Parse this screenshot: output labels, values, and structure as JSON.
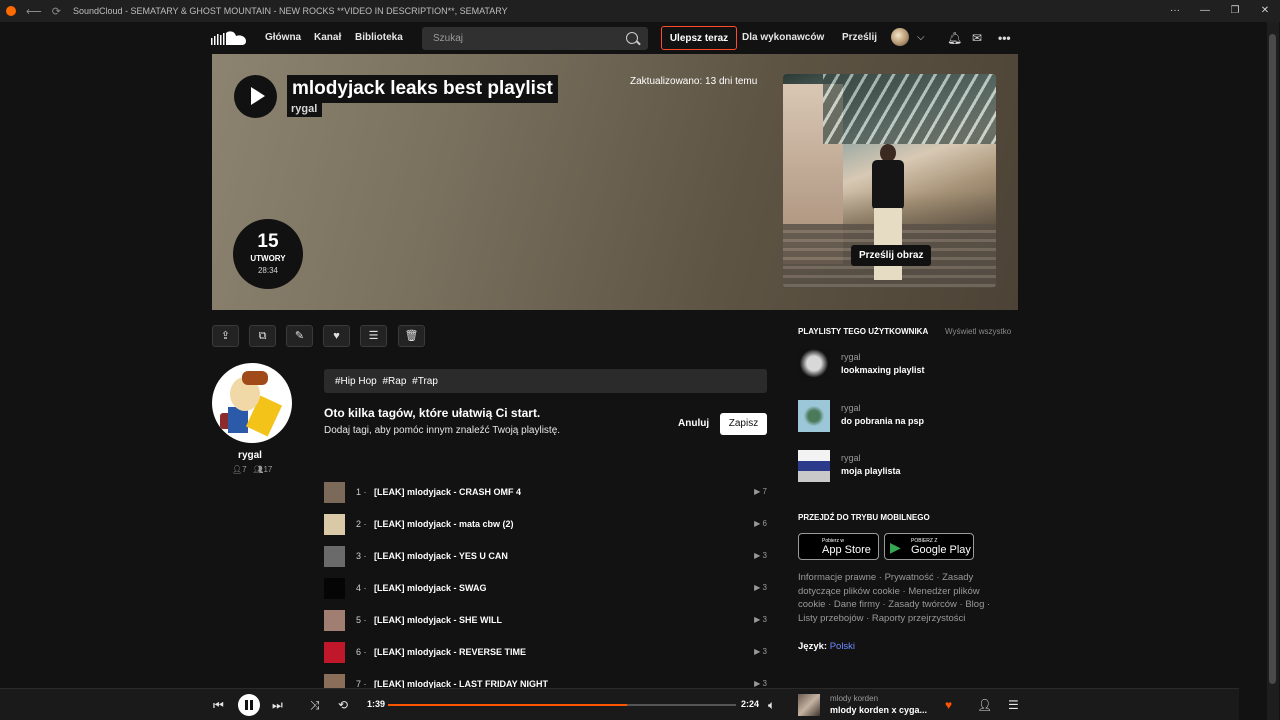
{
  "window": {
    "title": "SoundCloud - SEMATARY & GHOST MOUNTAIN - NEW ROCKS **VIDEO IN DESCRIPTION**, SEMATARY"
  },
  "nav": {
    "home": "Główna",
    "feed": "Kanał",
    "library": "Biblioteka",
    "search_placeholder": "Szukaj",
    "upgrade": "Ulepsz teraz",
    "for_artists": "Dla wykonawców",
    "upload": "Prześlij"
  },
  "playlist": {
    "title": "mlodyjack leaks best playlist",
    "user": "rygal",
    "updated": "Zaktualizowano: 13 dni temu",
    "track_count": "15",
    "track_label": "UTWORY",
    "duration": "28:34",
    "upload_image": "Prześlij obraz"
  },
  "user": {
    "name": "rygal",
    "followers": "7",
    "following": "17"
  },
  "tags": [
    "#Hip Hop",
    "#Rap",
    "#Trap"
  ],
  "tip": {
    "title": "Oto kilka tagów, które ułatwią Ci start.",
    "subtitle": "Dodaj tagi, aby pomóc innym znaleźć Twoją playlistę.",
    "cancel": "Anuluj",
    "save": "Zapisz"
  },
  "tracks": [
    {
      "num": "1",
      "title": "[LEAK] mlodyjack - CRASH OMF 4",
      "plays": "7",
      "color": "#7b6a5a"
    },
    {
      "num": "2",
      "title": "[LEAK] mlodyjack - mata cbw (2)",
      "plays": "6",
      "color": "#d9c9a6"
    },
    {
      "num": "3",
      "title": "[LEAK] mlodyjack - YES U CAN",
      "plays": "3",
      "color": "#6a6a6a"
    },
    {
      "num": "4",
      "title": "[LEAK] mlodyjack - SWAG",
      "plays": "3",
      "color": "#050505"
    },
    {
      "num": "5",
      "title": "[LEAK] mlodyjack - SHE WILL",
      "plays": "3",
      "color": "#a07f72"
    },
    {
      "num": "6",
      "title": "[LEAK] mlodyjack - REVERSE TIME",
      "plays": "3",
      "color": "#c0182a"
    },
    {
      "num": "7",
      "title": "[LEAK] mlodyjack - LAST FRIDAY NIGHT",
      "plays": "3",
      "color": "#8a6e5a"
    }
  ],
  "sidebar": {
    "heading": "PLAYLISTY TEGO UŻYTKOWNIKA",
    "view_all": "Wyświetl wszystko",
    "playlists": [
      {
        "user": "rygal",
        "title": "lookmaxing playlist",
        "color": "#2a2a2a"
      },
      {
        "user": "rygal",
        "title": "do pobrania na psp",
        "color": "#8fb8c9"
      },
      {
        "user": "rygal",
        "title": "moja playlista",
        "color": "#dfe4ea"
      }
    ],
    "mobile_heading": "PRZEJDŹ DO TRYBU MOBILNEGO",
    "appstore_small": "Pobierz w",
    "appstore": "App Store",
    "googleplay_small": "POBIERZ Z",
    "googleplay": "Google Play",
    "footer_links": "Informacje prawne · Prywatność · Zasady dotyczące plików cookie · Menedżer plików cookie · Dane firmy · Zasady twórców · Blog · Listy przebojów · Raporty przejrzystości",
    "language_label": "Język:",
    "language_value": "Polski"
  },
  "player": {
    "elapsed": "1:39",
    "total": "2:24",
    "progress": 0.687,
    "artist": "mlody korden",
    "title": "mlody korden x cyga..."
  },
  "colors": {
    "accent": "#ff5500",
    "like": "#ff5500",
    "language_link": "#6d8bff"
  }
}
